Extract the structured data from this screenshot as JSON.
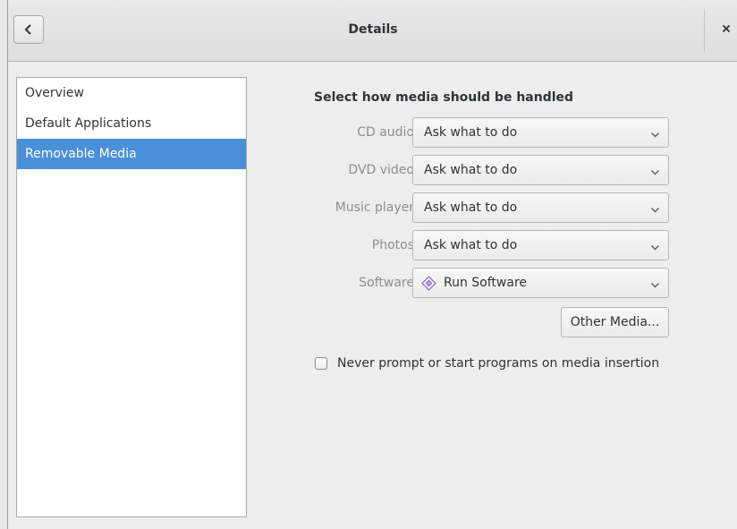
{
  "header": {
    "title": "Details",
    "back_icon": "chevron-left-icon",
    "close_icon": "close-icon"
  },
  "sidebar": {
    "items": [
      {
        "label": "Overview",
        "selected": false
      },
      {
        "label": "Default Applications",
        "selected": false
      },
      {
        "label": "Removable Media",
        "selected": true
      }
    ]
  },
  "main": {
    "heading": "Select how media should be handled",
    "rows": [
      {
        "label": "CD audio",
        "value": "Ask what to do"
      },
      {
        "label": "DVD video",
        "value": "Ask what to do"
      },
      {
        "label": "Music player",
        "value": "Ask what to do"
      },
      {
        "label": "Photos",
        "value": "Ask what to do"
      },
      {
        "label": "Software",
        "value": "Run Software",
        "icon": "software-icon"
      }
    ],
    "other_media_label": "Other Media...",
    "never_prompt": {
      "label": "Never prompt or start programs on media insertion",
      "checked": false
    }
  },
  "colors": {
    "accent": "#4a90d9",
    "dim_label": "#8b8e8f",
    "text": "#2e3436",
    "software_icon": "#8f78c9"
  }
}
